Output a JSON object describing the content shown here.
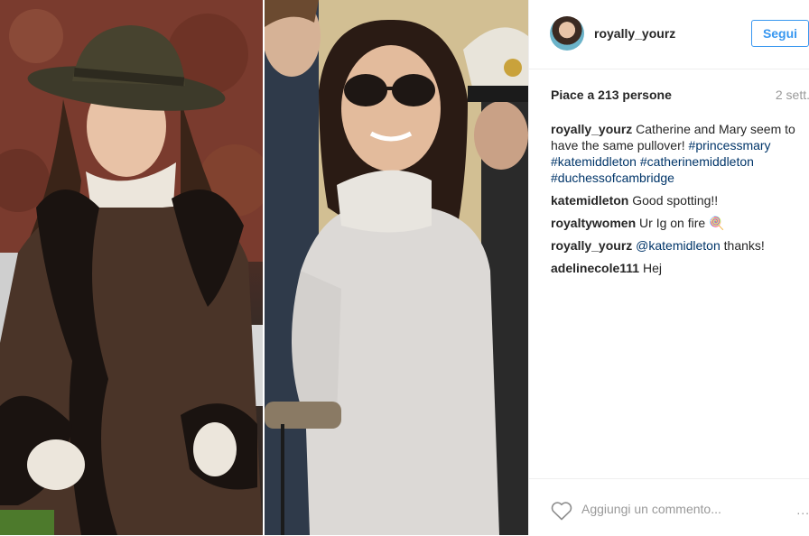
{
  "post": {
    "username": "royally_yourz",
    "follow_label": "Segui",
    "likes": "Piace a 213 persone",
    "time": "2 sett.",
    "caption": {
      "user": "royally_yourz",
      "text": "Catherine and Mary seem to have the same pullover!",
      "tags": [
        "#princessmary",
        "#katemiddleton",
        "#catherinemiddleton",
        "#duchessofcambridge"
      ]
    },
    "comments": [
      {
        "user": "katemidleton",
        "text": "Good spotting!!"
      },
      {
        "user": "royaltywomen",
        "text": "Ur Ig on fire",
        "emoji": "🍭"
      },
      {
        "user": "royally_yourz",
        "mention": "@katemidleton",
        "text": "thanks!"
      },
      {
        "user": "adelinecole111",
        "text": "Hej"
      }
    ],
    "add_comment_placeholder": "Aggiungi un commento...",
    "more_label": "..."
  },
  "colors": {
    "accent": "#3897f0",
    "hashtag": "#003569",
    "muted": "#999999"
  },
  "icons": {
    "like": "heart-icon",
    "more": "more-options-icon"
  }
}
